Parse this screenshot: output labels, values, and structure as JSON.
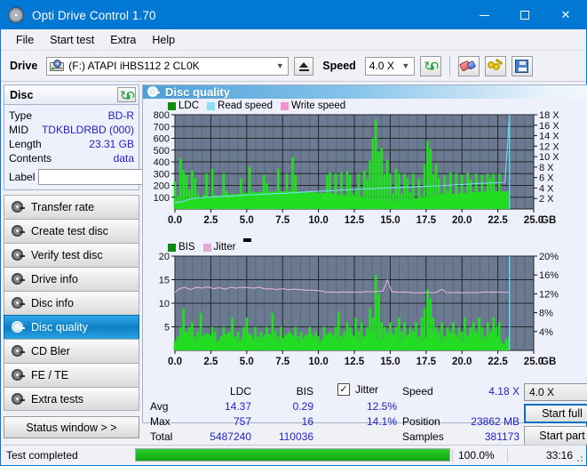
{
  "window": {
    "title": "Opti Drive Control 1.70",
    "icon": "disc-icon",
    "minimize": "minimize-icon",
    "maximize": "maximize-icon",
    "close": "close-icon"
  },
  "menu": [
    "File",
    "Start test",
    "Extra",
    "Help"
  ],
  "toolbar": {
    "drive_label": "Drive",
    "drive_value": "(F:)  ATAPI iHBS112  2 CL0K",
    "eject": "eject-icon",
    "speed_label": "Speed",
    "speed_value": "4.0 X",
    "refresh": "refresh-icon",
    "erase": "eraser-icon",
    "key": "key-icon",
    "save": "save-icon"
  },
  "disc": {
    "title": "Disc",
    "refresh_icon": "refresh-icon",
    "rows": [
      {
        "key": "Type",
        "value": "BD-R"
      },
      {
        "key": "MID",
        "value": "TDKBLDRBD (000)"
      },
      {
        "key": "Length",
        "value": "23.31 GB"
      },
      {
        "key": "Contents",
        "value": "data"
      }
    ],
    "label_key": "Label",
    "label_value": "",
    "label_placeholder": "",
    "disc_icon": "disc-icon"
  },
  "nav": {
    "items": [
      {
        "label": "Transfer rate",
        "selected": false
      },
      {
        "label": "Create test disc",
        "selected": false
      },
      {
        "label": "Verify test disc",
        "selected": false
      },
      {
        "label": "Drive info",
        "selected": false
      },
      {
        "label": "Disc info",
        "selected": false
      },
      {
        "label": "Disc quality",
        "selected": true
      },
      {
        "label": "CD Bler",
        "selected": false
      },
      {
        "label": "FE / TE",
        "selected": false
      },
      {
        "label": "Extra tests",
        "selected": false
      }
    ],
    "status_window": "Status window > >"
  },
  "panel": {
    "title": "Disc quality"
  },
  "stats": {
    "col_headers": [
      "LDC",
      "BIS"
    ],
    "rows": [
      {
        "label": "Avg",
        "ldc": "14.37",
        "bis": "0.29",
        "jitter": "12.5%"
      },
      {
        "label": "Max",
        "ldc": "757",
        "bis": "16",
        "jitter": "14.1%"
      },
      {
        "label": "Total",
        "ldc": "5487240",
        "bis": "110036",
        "jitter": ""
      }
    ],
    "jitter_label": "Jitter",
    "jitter_checked": true,
    "speed_label": "Speed",
    "speed_value": "4.18 X",
    "position_label": "Position",
    "position_value": "23862 MB",
    "samples_label": "Samples",
    "samples_value": "381173",
    "speed_select": "4.0 X",
    "start_full": "Start full",
    "start_part": "Start part"
  },
  "statusbar": {
    "text": "Test completed",
    "percent": "100.0%",
    "progress": 100,
    "time": "33:16"
  },
  "colors": {
    "accent": "#0078d4",
    "plot_bg": "#6b7a91",
    "ldc_green": "#22dd22",
    "bis_green": "#22dd22",
    "read_speed": "#7fdfff",
    "write_speed": "#ff7fd0",
    "jitter_pink": "#e8b8e0",
    "value_blue": "#2222cc"
  },
  "chart_data": [
    {
      "type": "area",
      "name": "ldc-chart",
      "title": "",
      "xlabel": "GB",
      "ylabel": "",
      "xlim": [
        0,
        25.0
      ],
      "ylim": [
        0,
        800
      ],
      "y2lim": [
        0,
        18
      ],
      "y2label": "X",
      "xticks": [
        "0.0",
        "2.5",
        "5.0",
        "7.5",
        "10.0",
        "12.5",
        "15.0",
        "17.5",
        "20.0",
        "22.5",
        "25.0"
      ],
      "yticks": [
        "100",
        "200",
        "300",
        "400",
        "500",
        "600",
        "700",
        "800"
      ],
      "y2ticks": [
        "2 X",
        "4 X",
        "6 X",
        "8 X",
        "10 X",
        "12 X",
        "14 X",
        "16 X",
        "18 X"
      ],
      "legend": [
        "LDC",
        "Read speed",
        "Write speed"
      ],
      "legend_position": "top-left",
      "grid": true,
      "data_end_gb": 23.31,
      "series": [
        {
          "name": "LDC",
          "color": "#22dd22",
          "x": [
            0.0,
            0.2,
            0.4,
            0.6,
            0.8,
            1.0,
            1.2,
            1.4,
            1.6,
            1.8,
            2.0,
            2.2,
            2.4,
            2.6,
            2.8,
            3.0,
            3.2,
            3.4,
            3.6,
            3.8,
            4.0,
            4.2,
            4.4,
            4.6,
            4.8,
            5.0,
            5.2,
            5.4,
            5.6,
            5.8,
            6.0,
            6.2,
            6.4,
            6.6,
            6.8,
            7.0,
            7.2,
            7.4,
            7.6,
            7.8,
            8.0,
            8.2,
            8.4,
            8.6,
            8.8,
            9.0,
            9.2,
            9.4,
            9.6,
            9.8,
            10.0,
            10.2,
            10.4,
            10.6,
            10.8,
            11.0,
            11.2,
            11.4,
            11.6,
            11.8,
            12.0,
            12.2,
            12.4,
            12.6,
            12.8,
            13.0,
            13.2,
            13.4,
            13.6,
            13.8,
            14.0,
            14.2,
            14.4,
            14.6,
            14.8,
            15.0,
            15.2,
            15.4,
            15.6,
            15.8,
            16.0,
            16.2,
            16.4,
            16.6,
            16.8,
            17.0,
            17.2,
            17.4,
            17.6,
            17.8,
            18.0,
            18.2,
            18.4,
            18.6,
            18.8,
            19.0,
            19.2,
            19.4,
            19.6,
            19.8,
            20.0,
            20.2,
            20.4,
            20.6,
            20.8,
            21.0,
            21.2,
            21.4,
            21.6,
            21.8,
            22.0,
            22.2,
            22.4,
            22.6,
            22.8,
            23.0,
            23.2,
            23.31
          ],
          "values": [
            235,
            110,
            430,
            330,
            290,
            160,
            330,
            260,
            130,
            95,
            120,
            300,
            90,
            340,
            120,
            80,
            115,
            300,
            150,
            90,
            130,
            60,
            95,
            260,
            130,
            70,
            360,
            150,
            90,
            130,
            70,
            290,
            220,
            130,
            110,
            60,
            340,
            65,
            120,
            300,
            80,
            440,
            290,
            110,
            130,
            80,
            120,
            60,
            95,
            75,
            110,
            80,
            130,
            290,
            310,
            130,
            300,
            90,
            310,
            110,
            320,
            290,
            130,
            160,
            300,
            110,
            330,
            250,
            410,
            600,
            760,
            480,
            520,
            300,
            420,
            300,
            130,
            340,
            300,
            130,
            300,
            260,
            140,
            300,
            90,
            260,
            110,
            380,
            580,
            510,
            300,
            380,
            260,
            130,
            290,
            160,
            310,
            120,
            300,
            120,
            290,
            130,
            310,
            250,
            130,
            300,
            110,
            290,
            130,
            300,
            260,
            300,
            130,
            300
          ]
        },
        {
          "name": "Read speed",
          "color": "#7fdfff",
          "x": [
            0.0,
            0.5,
            1.0,
            1.6,
            2.2,
            3.0,
            4.0,
            5.0,
            6.2,
            7.4,
            8.5,
            9.5,
            10.6,
            11.6,
            12.6,
            13.6,
            14.6,
            15.6,
            16.6,
            17.6,
            18.6,
            19.6,
            20.6,
            21.4,
            22.2,
            23.0,
            23.31
          ],
          "values": [
            55,
            60,
            82,
            95,
            100,
            105,
            110,
            118,
            125,
            132,
            140,
            148,
            153,
            160,
            168,
            172,
            178,
            182,
            188,
            193,
            198,
            205,
            212,
            218,
            222,
            225,
            800
          ]
        },
        {
          "name": "Write speed",
          "color": "#ff7fd0",
          "x": [],
          "values": []
        }
      ]
    },
    {
      "type": "area",
      "name": "bis-chart",
      "title": "",
      "xlabel": "GB",
      "ylabel": "",
      "xlim": [
        0,
        25.0
      ],
      "ylim": [
        0,
        20
      ],
      "y2lim": [
        0,
        20
      ],
      "y2label": "%",
      "xticks": [
        "0.0",
        "2.5",
        "5.0",
        "7.5",
        "10.0",
        "12.5",
        "15.0",
        "17.5",
        "20.0",
        "22.5",
        "25.0"
      ],
      "yticks": [
        "5",
        "10",
        "15",
        "20"
      ],
      "y2ticks": [
        "4%",
        "8%",
        "12%",
        "16%",
        "20%"
      ],
      "legend": [
        "BIS",
        "Jitter"
      ],
      "legend_position": "top-left",
      "grid": true,
      "data_end_gb": 23.31,
      "series": [
        {
          "name": "BIS",
          "color": "#22dd22",
          "x": [
            0.0,
            0.2,
            0.4,
            0.6,
            0.8,
            1.0,
            1.2,
            1.4,
            1.6,
            1.8,
            2.0,
            2.2,
            2.4,
            2.6,
            2.8,
            3.0,
            3.2,
            3.4,
            3.6,
            3.8,
            4.0,
            4.2,
            4.4,
            4.6,
            4.8,
            5.0,
            5.2,
            5.4,
            5.6,
            5.8,
            6.0,
            6.2,
            6.4,
            6.6,
            6.8,
            7.0,
            7.2,
            7.4,
            7.6,
            7.8,
            8.0,
            8.2,
            8.4,
            8.6,
            8.8,
            9.0,
            9.2,
            9.4,
            9.6,
            9.8,
            10.0,
            10.2,
            10.4,
            10.6,
            10.8,
            11.0,
            11.2,
            11.4,
            11.6,
            11.8,
            12.0,
            12.2,
            12.4,
            12.6,
            12.8,
            13.0,
            13.2,
            13.4,
            13.6,
            13.8,
            14.0,
            14.2,
            14.4,
            14.6,
            14.8,
            15.0,
            15.2,
            15.4,
            15.6,
            15.8,
            16.0,
            16.2,
            16.4,
            16.6,
            16.8,
            17.0,
            17.2,
            17.4,
            17.6,
            17.8,
            18.0,
            18.2,
            18.4,
            18.6,
            18.8,
            19.0,
            19.2,
            19.4,
            19.6,
            19.8,
            20.0,
            20.2,
            20.4,
            20.6,
            20.8,
            21.0,
            21.2,
            21.4,
            21.6,
            21.8,
            22.0,
            22.2,
            22.4,
            22.6,
            22.8,
            23.0,
            23.2,
            23.31
          ],
          "values": [
            2,
            3,
            5,
            9,
            4,
            5,
            6,
            3,
            4,
            8,
            3,
            2,
            3,
            5,
            4,
            2,
            3,
            5,
            2,
            4,
            7,
            3,
            4,
            2,
            5,
            7,
            3,
            2,
            5,
            3,
            4,
            2,
            5,
            3,
            8,
            4,
            3,
            5,
            2,
            3,
            4,
            2,
            5,
            3,
            4,
            2,
            3,
            5,
            2,
            4,
            3,
            2,
            5,
            3,
            4,
            2,
            5,
            8,
            3,
            4,
            6,
            5,
            3,
            7,
            4,
            6,
            3,
            5,
            9,
            7,
            16,
            12,
            6,
            5,
            4,
            6,
            3,
            5,
            7,
            4,
            6,
            3,
            5,
            4,
            6,
            3,
            7,
            9,
            13,
            11,
            7,
            5,
            4,
            6,
            3,
            5,
            4,
            6,
            3,
            5,
            4,
            7,
            3,
            5,
            6,
            4,
            7,
            5,
            3,
            6,
            4,
            7,
            5,
            6
          ]
        },
        {
          "name": "Jitter",
          "color": "#e8b8e0",
          "x": [
            0.0,
            0.3,
            0.7,
            1.1,
            1.5,
            1.9,
            2.3,
            2.7,
            3.1,
            3.5,
            3.9,
            4.3,
            4.7,
            5.1,
            5.5,
            5.9,
            6.3,
            6.7,
            7.1,
            7.5,
            7.9,
            8.3,
            8.7,
            9.1,
            9.5,
            9.9,
            10.3,
            10.5,
            10.9,
            11.3,
            11.7,
            12.1,
            12.5,
            12.9,
            13.3,
            13.7,
            14.1,
            14.5,
            14.8,
            15.1,
            15.5,
            15.9,
            16.3,
            16.7,
            17.1,
            17.5,
            17.9,
            18.3,
            18.6,
            18.9,
            19.3,
            19.7,
            20.1,
            20.5,
            20.9,
            21.3,
            21.7,
            22.1,
            22.5,
            22.9,
            23.2,
            23.31
          ],
          "values": [
            12.3,
            13.1,
            13.4,
            12.9,
            13.4,
            13.2,
            13.5,
            13.1,
            13.3,
            13.0,
            13.4,
            13.2,
            13.4,
            13.3,
            13.2,
            13.4,
            13.0,
            13.1,
            12.9,
            13.1,
            12.9,
            13.0,
            12.9,
            12.8,
            12.8,
            12.7,
            12.6,
            12.3,
            12.4,
            12.3,
            12.4,
            12.3,
            12.4,
            12.3,
            12.5,
            12.4,
            12.5,
            12.6,
            15.0,
            12.5,
            12.3,
            12.4,
            12.3,
            12.2,
            12.2,
            12.3,
            12.2,
            12.4,
            13.0,
            12.3,
            12.2,
            12.3,
            12.2,
            12.3,
            12.2,
            12.3,
            12.4,
            12.3,
            12.4,
            12.3,
            12.3,
            12.3
          ]
        }
      ]
    }
  ]
}
